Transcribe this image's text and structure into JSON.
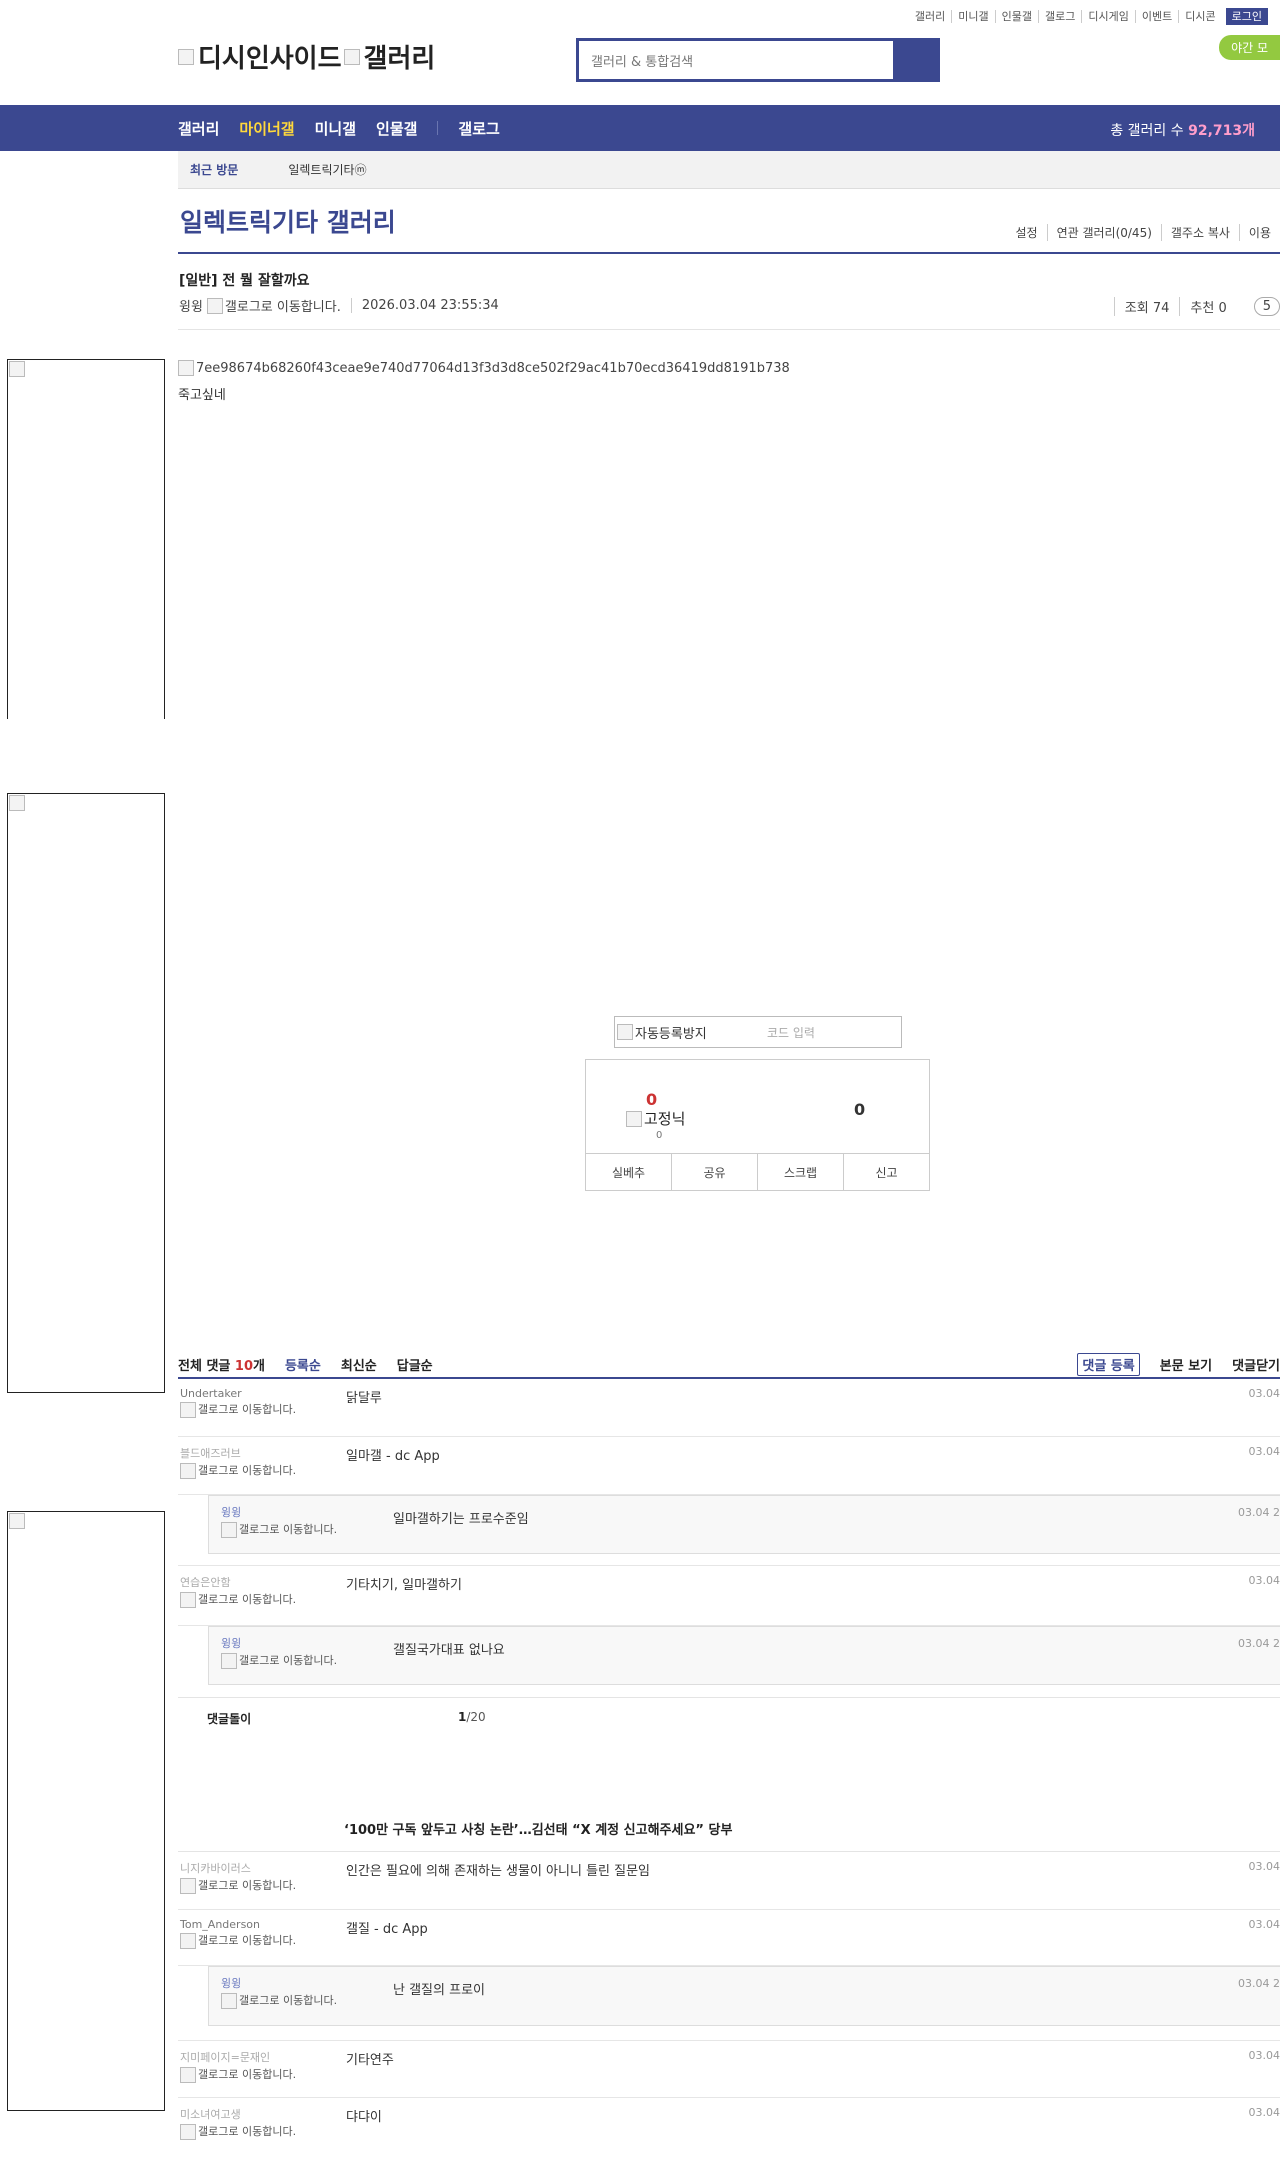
{
  "top_nav": [
    "갤러리",
    "미니갤",
    "인물갤",
    "갤로그",
    "디시게임",
    "이벤트",
    "디시콘"
  ],
  "login": "로그인",
  "night_mode": "야간 모",
  "logo": {
    "alt1": "디시인사이드",
    "alt2": "갤러리"
  },
  "search": {
    "placeholder": "갤러리 & 통합검색"
  },
  "gnb": {
    "items": [
      "갤러리",
      "마이너갤",
      "미니갤",
      "인물갤",
      "갤로그"
    ],
    "count_label": "총 갤러리 수 ",
    "count_value": "92,713개"
  },
  "subbar": {
    "recent": "최근 방문",
    "item": "일렉트릭기타ⓜ"
  },
  "gallery": {
    "title": "일렉트릭기타 갤러리",
    "utils": [
      "설정",
      "연관 갤러리(0/45)",
      "갤주소 복사",
      "이용"
    ]
  },
  "post": {
    "title": "[일반] 전 뭘 잘할까요",
    "author": "윙윙",
    "badge_alt": "갤로그로 이동합니다.",
    "date": "2026.03.04 23:55:34",
    "views": "조회 74",
    "recommend": "추천 0",
    "pill": "5",
    "image_alt": "7ee98674b68260f43ceae9e740d77064d13f3d3d8ce502f29ac41b70ecd36419dd8191b738",
    "body": "죽고싶네"
  },
  "captcha": {
    "img_alt": "자동등록방지",
    "placeholder": "코드 입력"
  },
  "vote": {
    "up": "0",
    "fixed_alt": "고정닉",
    "fixed_count": "0",
    "down": "0",
    "buttons": [
      "실베추",
      "공유",
      "스크랩",
      "신고"
    ]
  },
  "comments_header": {
    "total_label": "전체 댓글 ",
    "total_num": "10",
    "total_unit": "개",
    "sorts": [
      "등록순",
      "최신순",
      "답글순"
    ],
    "actions": [
      "댓글 등록",
      "본문 보기",
      "댓글닫기"
    ]
  },
  "comments": [
    {
      "nick": "Undertaker",
      "badge": "갤로그로 이동합니다.",
      "text": "닭달루",
      "date": "03.04"
    },
    {
      "nick": "블드애즈러브",
      "badge": "갤로그로 이동합니다.",
      "text": "일마갤 - dc App",
      "date": "03.04"
    },
    {
      "nick": "윙윙",
      "badge": "갤로그로 이동합니다.",
      "text": "일마갤하기는 프로수준임",
      "date": "03.04 2"
    },
    {
      "nick": "연습은안함",
      "badge": "갤로그로 이동합니다.",
      "text": "기타치기, 일마갤하기",
      "date": "03.04"
    },
    {
      "nick": "윙윙",
      "badge": "갤로그로 이동합니다.",
      "text": "갤질국가대표 없나요",
      "date": "03.04 2"
    },
    {
      "nick": "니지카바이러스",
      "badge": "갤로그로 이동합니다.",
      "text": "인간은 필요에 의해 존재하는 생물이 아니니 틀린 질문임",
      "date": "03.04"
    },
    {
      "nick": "Tom_Anderson",
      "badge": "갤로그로 이동합니다.",
      "text": "갤질 - dc App",
      "date": "03.04"
    },
    {
      "nick": "윙윙",
      "badge": "갤로그로 이동합니다.",
      "text": "난 갤질의 프로이",
      "date": "03.04 2"
    },
    {
      "nick": "지미페이지=문재인",
      "badge": "갤로그로 이동합니다.",
      "text": "기타연주",
      "date": "03.04"
    },
    {
      "nick": "미소녀여고생",
      "badge": "갤로그로 이동합니다.",
      "text": "댜댜이",
      "date": "03.04"
    }
  ],
  "dollim": {
    "label": "댓글돌이",
    "page": "1",
    "total": "/20"
  },
  "news": "‘100만 구독 앞두고 사칭 논란’…김선태 “X 계정 신고해주세요” 당부"
}
